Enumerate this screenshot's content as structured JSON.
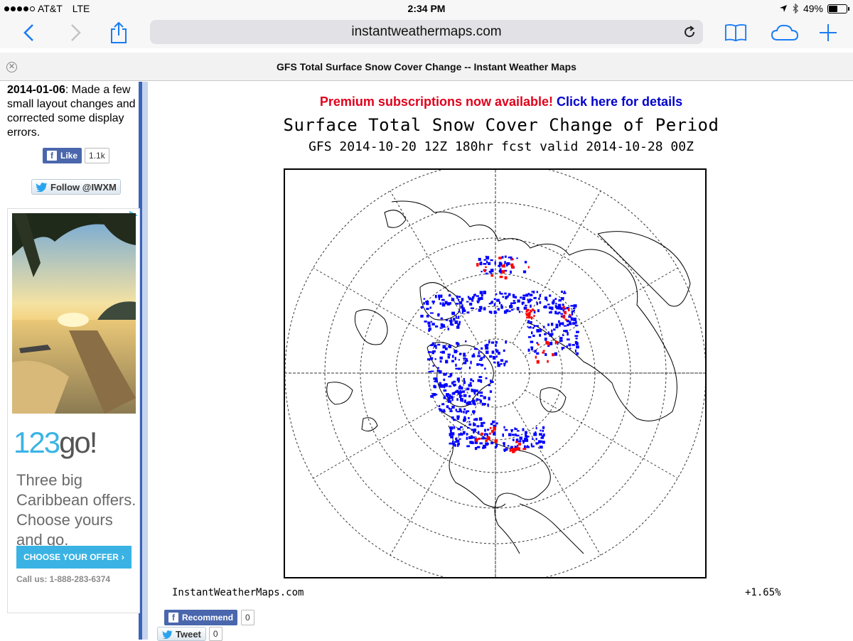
{
  "status_bar": {
    "carrier": "AT&T",
    "network": "LTE",
    "time": "2:34 PM",
    "battery": "49%",
    "battery_level": 0.49
  },
  "browser": {
    "url": "instantweathermaps.com",
    "tab_title": "GFS Total Surface Snow Cover Change -- Instant Weather Maps"
  },
  "sidebar": {
    "news_date": "2014-01-06",
    "news_text": ": Made a few small layout changes and corrected some display errors.",
    "fb_like_label": "Like",
    "fb_like_count": "1.1k",
    "twitter_follow_label": "Follow @IWXM"
  },
  "ad": {
    "logo_number": "123",
    "logo_go": "go!",
    "text": "Three big Caribbean offers. Choose yours and go.",
    "cta": "CHOOSE YOUR OFFER",
    "call": "Call us: 1-888-283-6374"
  },
  "main": {
    "premium_text": "Premium subscriptions now available!",
    "premium_link": "Click here for details",
    "map_title": "Surface Total Snow Cover Change of Period",
    "map_subtitle": "GFS 2014-10-20 12Z 180hr fcst valid 2014-10-28 00Z",
    "credit": "InstantWeatherMaps.com",
    "percent": "+1.65%",
    "recommend_label": "Recommend",
    "recommend_count": "0",
    "tweet_label": "Tweet",
    "tweet_count": "0"
  },
  "colors": {
    "snow_gain": "#0000ff",
    "snow_loss": "#ff0000",
    "sidebar_border": "#3a64b8",
    "facebook": "#4a66ad",
    "ad_accent": "#3ab3e4"
  }
}
